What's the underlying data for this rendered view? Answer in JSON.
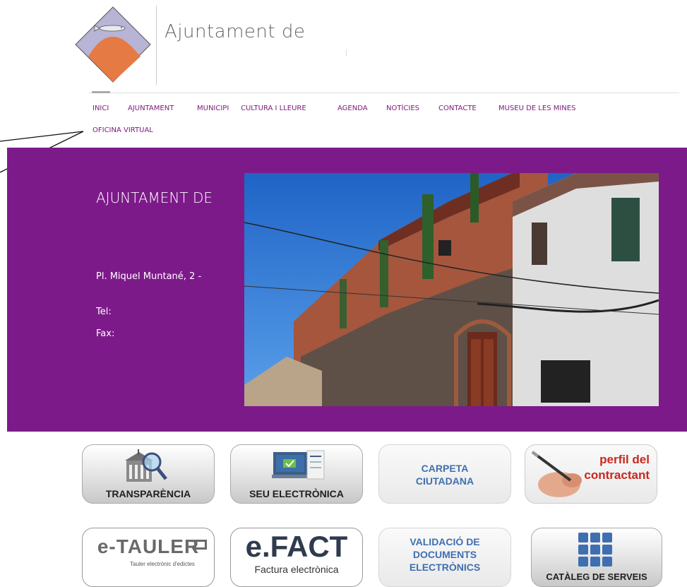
{
  "header": {
    "site_title": "Ajuntament de"
  },
  "nav": {
    "items": [
      "INICI",
      "AJUNTAMENT",
      "MUNICIPI",
      "CULTURA I LLEURE",
      "AGENDA",
      "NOTÍCIES",
      "CONTACTE",
      "MUSEU DE LES MINES",
      "OFICINA VIRTUAL"
    ]
  },
  "hero": {
    "title": "AJUNTAMENT DE",
    "address": "Pl. Miquel Muntané, 2 -",
    "tel_label": "Tel:",
    "fax_label": "Fax:"
  },
  "tiles": {
    "transparencia": "TRANSPARÈNCIA",
    "seu": "SEU ELECTRÒNICA",
    "carpeta_1": "CARPETA",
    "carpeta_2": "CIUTADANA",
    "perfil_1": "perfil del",
    "perfil_2": "contractant",
    "etauler_brand": "e-TAULER",
    "etauler_sub": "Tauler electrònic d'edictes",
    "efact_brand": "e.FACT",
    "efact_sub": "Factura electrònica",
    "validacio_1": "VALIDACIÓ DE",
    "validacio_2": "DOCUMENTS",
    "validacio_3": "ELECTRÒNICS",
    "cataleg": "CATÀLEG DE SERVEIS"
  },
  "colors": {
    "band": "#7d1a8a",
    "nav_text": "#7a1a7a",
    "logo_lilac": "#b7b4d6",
    "logo_orange": "#e57a45",
    "tile_blue": "#3f6fb0",
    "tile_orange": "#e2431c"
  }
}
